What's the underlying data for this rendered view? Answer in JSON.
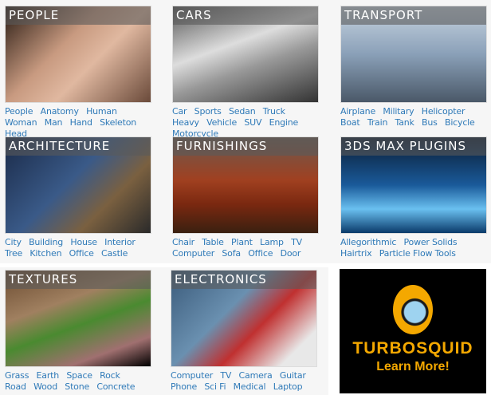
{
  "categories": [
    {
      "title": "PEOPLE",
      "links": [
        "People",
        "Anatomy",
        "Human",
        "Woman",
        "Man",
        "Hand",
        "Skeleton",
        "Head"
      ],
      "bg": "linear-gradient(135deg,#2a1c14 0%,#c89a80 40%,#e0b8a0 60%,#6a4a3a 100%)"
    },
    {
      "title": "CARS",
      "links": [
        "Car",
        "Sports",
        "Sedan",
        "Truck",
        "Heavy",
        "Vehicle",
        "SUV",
        "Engine",
        "Motorcycle"
      ],
      "bg": "linear-gradient(160deg,#555 0%,#ddd 40%,#999 60%,#333 100%)"
    },
    {
      "title": "TRANSPORT",
      "links": [
        "Airplane",
        "Military",
        "Helicopter",
        "Boat",
        "Train",
        "Tank",
        "Bus",
        "Bicycle"
      ],
      "bg": "linear-gradient(180deg,#c8d4e0 0%,#8aa0b8 50%,#4a5868 100%)"
    },
    {
      "title": "ARCHITECTURE",
      "links": [
        "City",
        "Building",
        "House",
        "Interior",
        "Tree",
        "Kitchen",
        "Office",
        "Castle"
      ],
      "bg": "linear-gradient(135deg,#1a2a48 0%,#3a5a88 45%,#7a6040 70%,#2a2a2a 100%)"
    },
    {
      "title": "FURNISHINGS",
      "links": [
        "Chair",
        "Table",
        "Plant",
        "Lamp",
        "TV",
        "Computer",
        "Sofa",
        "Office",
        "Door"
      ],
      "bg": "linear-gradient(180deg,#6a5a50 0%,#a04020 45%,#7a2810 70%,#3a2010 100%)"
    },
    {
      "title": "3DS MAX PLUGINS",
      "links": [
        "Allegorithmic",
        "Power Solids",
        "Hairtrix",
        "Particle Flow Tools"
      ],
      "bg": "linear-gradient(180deg,#0a1a30 0%,#1a5a9a 50%,#6ac0f0 75%,#0a3a6a 100%)"
    },
    {
      "title": "TEXTURES",
      "links": [
        "Grass",
        "Earth",
        "Space",
        "Rock",
        "Road",
        "Wood",
        "Stone",
        "Concrete"
      ],
      "bg": "linear-gradient(160deg,#6a4a30 0%,#a08060 35%,#4a8a30 55%,#a07070 80%,#000 100%)"
    },
    {
      "title": "ELECTRONICS",
      "links": [
        "Computer",
        "TV",
        "Camera",
        "Guitar",
        "Phone",
        "Sci Fi",
        "Medical",
        "Laptop"
      ],
      "bg": "linear-gradient(135deg,#3a5a7a 0%,#6a90b0 40%,#c03030 60%,#e8e8e8 85%)"
    }
  ],
  "ad": {
    "brand": "TurboSquid",
    "cta": "Learn More!",
    "accent": "#f4a800"
  },
  "link_color": "#2f7ab8"
}
